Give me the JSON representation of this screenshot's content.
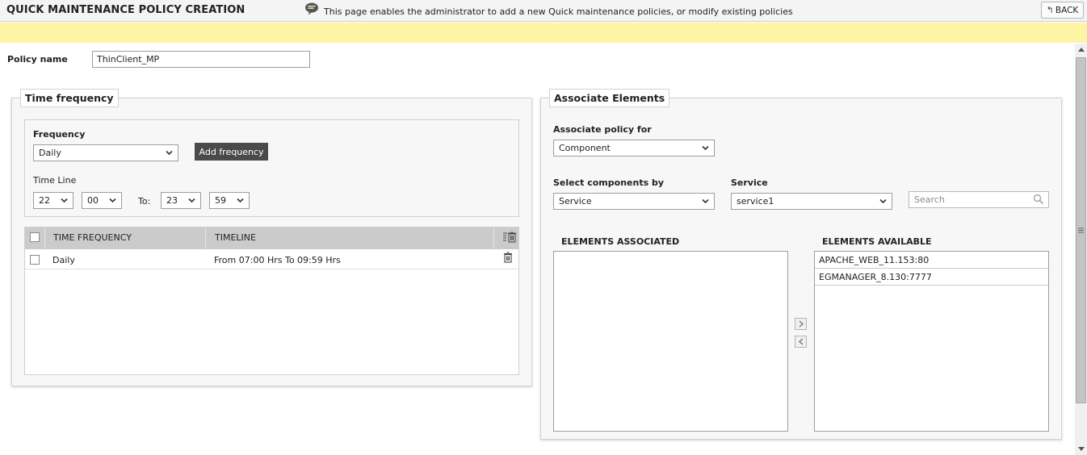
{
  "header": {
    "title": "QUICK MAINTENANCE POLICY CREATION",
    "back_label": "BACK"
  },
  "info": {
    "text": "This page enables the administrator to add a new Quick maintenance policies, or modify existing policies"
  },
  "policy": {
    "label": "Policy name",
    "value": "ThinClient_MP"
  },
  "time_frequency": {
    "legend": "Time frequency",
    "frequency_label": "Frequency",
    "frequency_value": "Daily",
    "add_button": "Add frequency",
    "timeline_label": "Time Line",
    "from_hour": "22",
    "from_min": "00",
    "to_label": "To:",
    "to_hour": "23",
    "to_min": "59",
    "table": {
      "columns": [
        "TIME FREQUENCY",
        "TIMELINE"
      ],
      "rows": [
        {
          "frequency": "Daily",
          "timeline": "From 07:00 Hrs To 09:59 Hrs"
        }
      ]
    }
  },
  "associate": {
    "legend": "Associate Elements",
    "policy_for_label": "Associate policy for",
    "policy_for_value": "Component",
    "select_by_label": "Select components by",
    "select_by_value": "Service",
    "service_label": "Service",
    "service_value": "service1",
    "search_placeholder": "Search",
    "associated_title": "ELEMENTS ASSOCIATED",
    "available_title": "ELEMENTS AVAILABLE",
    "available_items": [
      "APACHE_WEB_11.153:80",
      "EGMANAGER_8.130:7777"
    ]
  }
}
